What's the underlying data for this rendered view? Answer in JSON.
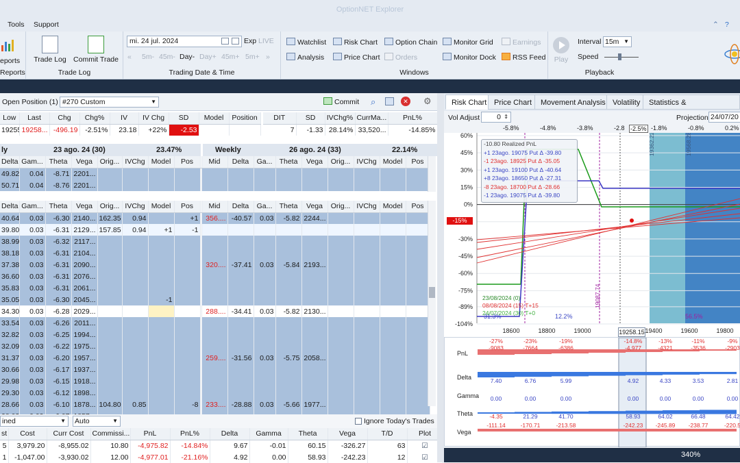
{
  "app": {
    "title": "OptionNET Explorer"
  },
  "menu": [
    "Tools",
    "Support"
  ],
  "ribbon": {
    "reports_label": "eports",
    "reports_group": "Reports",
    "trade_log": "Trade Log",
    "commit_trade": "Commit Trade",
    "trade_log_group": "Trade Log",
    "date_value": "mi. 24 jul. 2024",
    "exp_label": "Exp",
    "live_label": "LIVE",
    "steps": [
      "5m-",
      "45m-",
      "Day-",
      "Day+",
      "45m+",
      "5m+"
    ],
    "date_group": "Trading Date & Time",
    "windows": [
      "Watchlist",
      "Risk Chart",
      "Option Chain",
      "Monitor Grid",
      "Earnings",
      "Analysis",
      "Price Chart",
      "Orders",
      "Monitor Dock",
      "RSS Feed"
    ],
    "windows_group": "Windows",
    "play": "Play",
    "interval_label": "Interval",
    "interval_value": "15m",
    "speed_label": "Speed",
    "playback_group": "Playback"
  },
  "position": {
    "label": "Open Position (1)",
    "selected": "#270 Custom",
    "commit": "Commit"
  },
  "summary": {
    "headers": [
      "Low",
      "Last",
      "Chg",
      "Chg%",
      "IV",
      "IV Chg",
      "SD",
      "Model",
      "Position",
      "DIT",
      "SD",
      "IVChg%",
      "CurrMa...",
      "PnL%"
    ],
    "values": [
      "19255...",
      "19258...",
      "-496.19",
      "-2.51%",
      "23.18",
      "+22%",
      "-2.53",
      "",
      "",
      "7",
      "-1.33",
      "28.14%",
      "33,520...",
      "-14.85%"
    ]
  },
  "expiry1": {
    "left": "ly",
    "label": "23 ago. 24 (30)",
    "pct": "23.47%",
    "right": "Weekly",
    "label2": "26 ago. 24 (33)",
    "pct2": "22.14%"
  },
  "chain_headers": [
    "Delta",
    "Gam...",
    "Theta",
    "Vega",
    "Orig...",
    "IVChg",
    "Model",
    "Pos",
    "Mid",
    "Delta",
    "Ga...",
    "Theta",
    "Vega",
    "Orig...",
    "IVChg",
    "Model",
    "Pos"
  ],
  "chain_top": [
    [
      "49.82",
      "0.04",
      "-8.71",
      "2201..."
    ],
    [
      "50.71",
      "0.04",
      "-8.76",
      "2201..."
    ]
  ],
  "chain_rows": [
    {
      "c": [
        "40.64",
        "0.03",
        "-6.30",
        "2140...",
        "162.35",
        "0.94",
        "",
        "+1"
      ],
      "p": [
        "356....",
        "-40.57",
        "0.03",
        "-5.82",
        "2244..."
      ]
    },
    {
      "c": [
        "39.80",
        "0.03",
        "-6.31",
        "2129...",
        "157.85",
        "0.94",
        "+1",
        "-1"
      ],
      "p": []
    },
    {
      "c": [
        "38.99",
        "0.03",
        "-6.32",
        "2117..."
      ],
      "p": []
    },
    {
      "c": [
        "38.18",
        "0.03",
        "-6.31",
        "2104..."
      ],
      "p": []
    },
    {
      "c": [
        "37.38",
        "0.03",
        "-6.31",
        "2090..."
      ],
      "p": [
        "320....",
        "-37.41",
        "0.03",
        "-5.84",
        "2193..."
      ]
    },
    {
      "c": [
        "36.60",
        "0.03",
        "-6.31",
        "2076..."
      ],
      "p": []
    },
    {
      "c": [
        "35.83",
        "0.03",
        "-6.31",
        "2061..."
      ],
      "p": []
    },
    {
      "c": [
        "35.05",
        "0.03",
        "-6.30",
        "2045...",
        "",
        "",
        "-1",
        ""
      ],
      "p": []
    },
    {
      "c": [
        "34.30",
        "0.03",
        "-6.28",
        "2029..."
      ],
      "p": [
        "288....",
        "-34.41",
        "0.03",
        "-5.82",
        "2130..."
      ]
    },
    {
      "c": [
        "33.54",
        "0.03",
        "-6.26",
        "2011..."
      ],
      "p": []
    },
    {
      "c": [
        "32.82",
        "0.03",
        "-6.25",
        "1994..."
      ],
      "p": []
    },
    {
      "c": [
        "32.09",
        "0.03",
        "-6.22",
        "1975..."
      ],
      "p": []
    },
    {
      "c": [
        "31.37",
        "0.03",
        "-6.20",
        "1957..."
      ],
      "p": [
        "259....",
        "-31.56",
        "0.03",
        "-5.75",
        "2058..."
      ]
    },
    {
      "c": [
        "30.66",
        "0.03",
        "-6.17",
        "1937..."
      ],
      "p": []
    },
    {
      "c": [
        "29.98",
        "0.03",
        "-6.15",
        "1918..."
      ],
      "p": []
    },
    {
      "c": [
        "29.30",
        "0.03",
        "-6.12",
        "1898..."
      ],
      "p": []
    },
    {
      "c": [
        "28.66",
        "0.03",
        "-6.10",
        "1878...",
        "104.80",
        "0.85",
        "",
        "-8"
      ],
      "p": [
        "233....",
        "-28.88",
        "0.03",
        "-5.66",
        "1977..."
      ]
    },
    {
      "c": [
        "28.03",
        "0.03",
        "-6.07",
        "1857..."
      ],
      "p": []
    }
  ],
  "trades_bar": {
    "combined": "ined",
    "auto": "Auto",
    "ignore": "Ignore Today's Trades"
  },
  "trades": {
    "headers": [
      "st",
      "Cost",
      "Curr Cost",
      "Commissi...",
      "PnL",
      "PnL%",
      "Delta",
      "Gamma",
      "Theta",
      "Vega",
      "T/D",
      "Plot"
    ],
    "rows": [
      [
        "5",
        "3,979.20",
        "-8,955.02",
        "10.80",
        "-4,975.82",
        "-14.84%",
        "9.67",
        "-0.01",
        "60.15",
        "-326.27",
        "63",
        ""
      ],
      [
        "1",
        "-1,047.00",
        "-3,930.02",
        "12.00",
        "-4,977.01",
        "-21.16%",
        "4.92",
        "0.00",
        "58.93",
        "-242.23",
        "12",
        ""
      ]
    ]
  },
  "right": {
    "tabs": [
      "Risk Chart",
      "Price Chart",
      "Movement Analysis",
      "Volatility",
      "Statistics & Fundamentals"
    ],
    "vol_adjust": "Vol Adjust",
    "vol_value": "0",
    "projection": "Projection",
    "projection_value": "24/07/20",
    "top_pct": [
      "-5.8%",
      "-4.8%",
      "-3.8%",
      "-2.8",
      "-2.5%",
      "-1.8%",
      "-0.8%",
      "0.2%"
    ],
    "y_labels": [
      "60%",
      "45%",
      "30%",
      "15%",
      "0%",
      "-15%",
      "-30%",
      "-45%",
      "-60%",
      "-75%",
      "-89%",
      "-104%"
    ],
    "x_labels": [
      "18600",
      "18800",
      "19000",
      "19400",
      "19600",
      "19800"
    ],
    "cursor_x": "19258.15",
    "legend": [
      {
        "t": "-10.80 Realized PnL",
        "c": "#444"
      },
      {
        "t": "+1 23ago. 19075 Put Δ  -39.80",
        "c": "#3a46c4"
      },
      {
        "t": "-1 23ago. 18925 Put Δ  -35.05",
        "c": "#e03030"
      },
      {
        "t": "+1 23ago. 19100 Put Δ  -40.64",
        "c": "#3a46c4"
      },
      {
        "t": "+8 23ago. 18650 Put Δ  -27.31",
        "c": "#3a46c4"
      },
      {
        "t": "-8 23ago. 18700 Put Δ  -28.66",
        "c": "#e03030"
      },
      {
        "t": "-1 23ago. 19075 Put Δ  -39.80",
        "c": "#3a46c4"
      }
    ],
    "dates": [
      {
        "t": "23/08/2024 (0)",
        "c": "#2a8a2a"
      },
      {
        "t": "08/08/2024 (15) T+15",
        "c": "#e03030"
      },
      {
        "t": "24/07/2024 (30) T+0",
        "c": "#40b040"
      }
    ],
    "vlabels": [
      "19362.22",
      "19568.28",
      "19087.74"
    ],
    "pct_labels": [
      "31.3%",
      "12.2%",
      "56.5%"
    ],
    "neg_marker": "-15%",
    "bar_rows": [
      "PnL",
      "Delta",
      "Gamma",
      "Theta",
      "Vega"
    ],
    "pnl_pct": [
      "-27%",
      "-23%",
      "-19%",
      "-14.8%",
      "-13%",
      "-11%",
      "-9%"
    ],
    "pnl_vals": [
      "-9083",
      "-7664",
      "-6386",
      "-4,977",
      "-4321",
      "-3536",
      "-2903"
    ],
    "delta_vals": [
      "7.40",
      "6.76",
      "5.99",
      "4.92",
      "4.33",
      "3.53",
      "2.81"
    ],
    "gamma_vals": [
      "0.00",
      "0.00",
      "0.00",
      "0.00",
      "0.00",
      "0.00",
      "0.00"
    ],
    "theta_vals": [
      "-4.35",
      "21.29",
      "41.70",
      "58.93",
      "64.02",
      "66.48",
      "64.42"
    ],
    "vega_vals": [
      "-111.14",
      "-170.71",
      "-213.58",
      "-242.23",
      "-245.89",
      "-238.77",
      "-220.5"
    ],
    "zoom": "340%"
  }
}
